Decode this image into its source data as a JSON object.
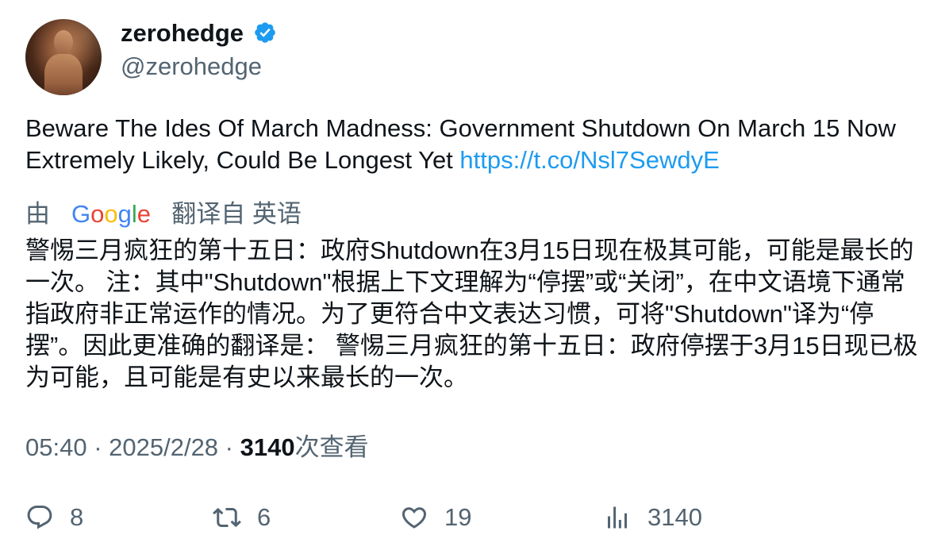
{
  "author": {
    "display_name": "zerohedge",
    "handle": "@zerohedge",
    "verified_icon": "verified-badge-icon",
    "badge_color": "#1d9bf0"
  },
  "tweet": {
    "text": "Beware The Ides Of March Madness: Government Shutdown On March 15 Now Extremely Likely, Could Be Longest Yet ",
    "link": "https://t.co/Nsl7SewdyE",
    "link_color": "#1d9bf0"
  },
  "translation": {
    "by_label": "由",
    "google_logo": "Google",
    "from_label": "翻译自 英语",
    "text": "警惕三月疯狂的第十五日：政府Shutdown在3月15日现在极其可能，可能是最长的一次。 注：其中\"Shutdown\"根据上下文理解为“停摆”或“关闭”，在中文语境下通常指政府非正常运作的情况。为了更符合中文表达习惯，可将\"Shutdown\"译为“停摆”。因此更准确的翻译是： 警惕三月疯狂的第十五日：政府停摆于3月15日现已极为可能，且可能是有史以来最长的一次。"
  },
  "meta": {
    "time": "05:40",
    "sep": " · ",
    "date": "2025/2/28",
    "views_count": "3140",
    "views_label": "次查看"
  },
  "actions": {
    "replies": "8",
    "reposts": "6",
    "likes": "19",
    "views": "3140"
  },
  "colors": {
    "text": "#0f1419",
    "secondary": "#536471",
    "accent": "#1d9bf0"
  }
}
